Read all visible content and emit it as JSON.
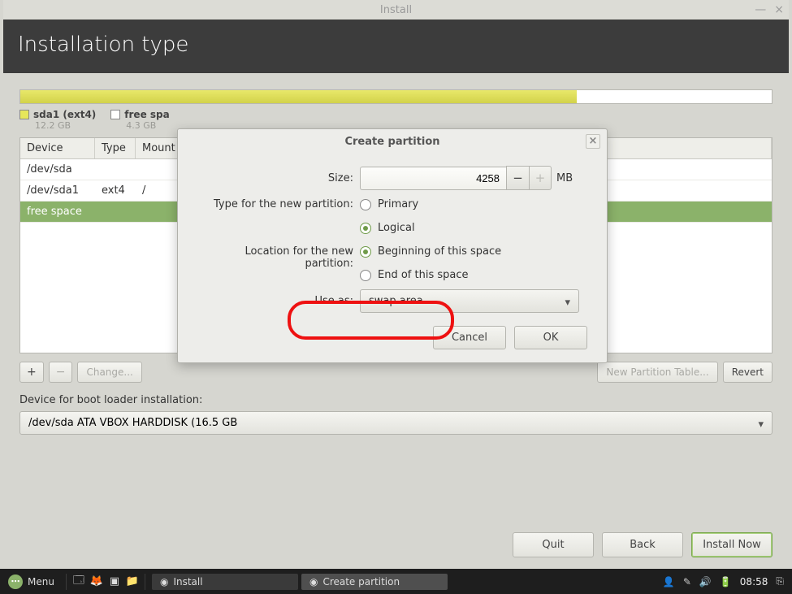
{
  "window": {
    "title": "Install",
    "heading": "Installation type"
  },
  "disk": {
    "legend": [
      {
        "label": "sda1 (ext4)",
        "size": "12.2 GB",
        "swatch": "yellow"
      },
      {
        "label": "free spa",
        "size": "4.3 GB",
        "swatch": "white"
      }
    ]
  },
  "table": {
    "columns": {
      "device": "Device",
      "type": "Type",
      "mount": "Mount"
    },
    "rows": [
      {
        "device": "/dev/sda",
        "type": "",
        "mount": "",
        "indent": false
      },
      {
        "device": "/dev/sda1",
        "type": "ext4",
        "mount": "/",
        "indent": true
      },
      {
        "device": "free space",
        "type": "",
        "mount": "",
        "indent": true,
        "selected": true
      }
    ]
  },
  "toolbar": {
    "add": "+",
    "remove": "−",
    "change": "Change...",
    "newtable": "New Partition Table...",
    "revert": "Revert"
  },
  "boot": {
    "label": "Device for boot loader installation:",
    "value": "/dev/sda   ATA VBOX HARDDISK (16.5 GB"
  },
  "footer": {
    "quit": "Quit",
    "back": "Back",
    "install": "Install Now"
  },
  "dialog": {
    "title": "Create partition",
    "size_label": "Size:",
    "size_value": "4258",
    "size_unit": "MB",
    "type_label": "Type for the new partition:",
    "type_primary": "Primary",
    "type_logical": "Logical",
    "loc_label": "Location for the new partition:",
    "loc_begin": "Beginning of this space",
    "loc_end": "End of this space",
    "useas_label": "Use as:",
    "useas_value": "swap area",
    "cancel": "Cancel",
    "ok": "OK"
  },
  "taskbar": {
    "menu": "Menu",
    "task1": "Install",
    "task2": "Create partition",
    "time": "08:58"
  }
}
